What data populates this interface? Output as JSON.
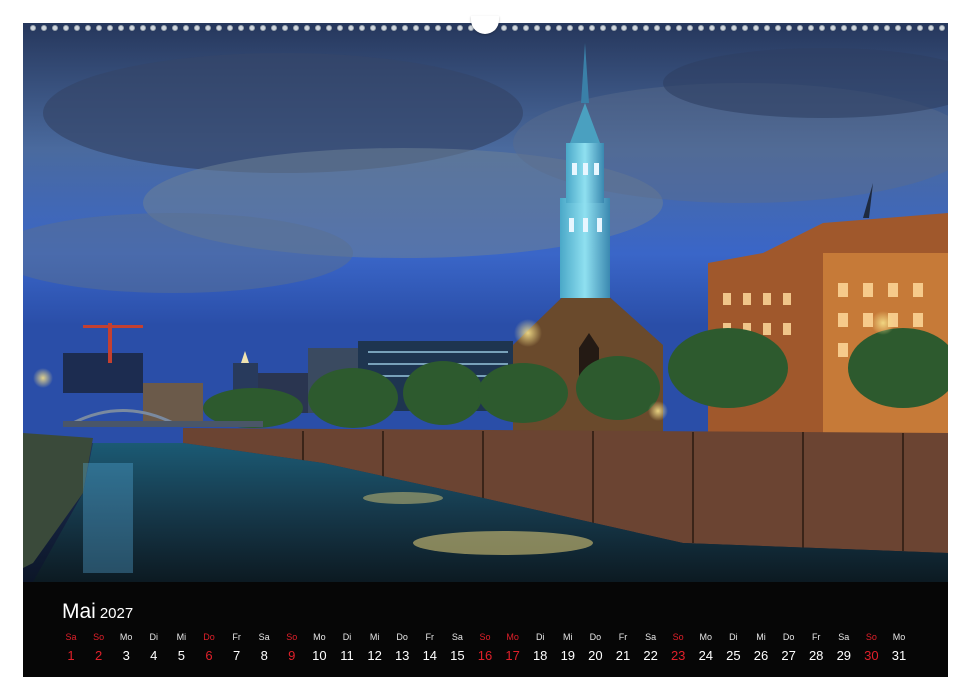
{
  "calendar": {
    "month": "Mai",
    "year": "2027",
    "days": [
      {
        "wd": "Sa",
        "num": "1",
        "red": true
      },
      {
        "wd": "So",
        "num": "2",
        "red": true
      },
      {
        "wd": "Mo",
        "num": "3",
        "red": false
      },
      {
        "wd": "Di",
        "num": "4",
        "red": false
      },
      {
        "wd": "Mi",
        "num": "5",
        "red": false
      },
      {
        "wd": "Do",
        "num": "6",
        "red": true
      },
      {
        "wd": "Fr",
        "num": "7",
        "red": false
      },
      {
        "wd": "Sa",
        "num": "8",
        "red": false
      },
      {
        "wd": "So",
        "num": "9",
        "red": true
      },
      {
        "wd": "Mo",
        "num": "10",
        "red": false
      },
      {
        "wd": "Di",
        "num": "11",
        "red": false
      },
      {
        "wd": "Mi",
        "num": "12",
        "red": false
      },
      {
        "wd": "Do",
        "num": "13",
        "red": false
      },
      {
        "wd": "Fr",
        "num": "14",
        "red": false
      },
      {
        "wd": "Sa",
        "num": "15",
        "red": false
      },
      {
        "wd": "So",
        "num": "16",
        "red": true
      },
      {
        "wd": "Mo",
        "num": "17",
        "red": true
      },
      {
        "wd": "Di",
        "num": "18",
        "red": false
      },
      {
        "wd": "Mi",
        "num": "19",
        "red": false
      },
      {
        "wd": "Do",
        "num": "20",
        "red": false
      },
      {
        "wd": "Fr",
        "num": "21",
        "red": false
      },
      {
        "wd": "Sa",
        "num": "22",
        "red": false
      },
      {
        "wd": "So",
        "num": "23",
        "red": true
      },
      {
        "wd": "Mo",
        "num": "24",
        "red": false
      },
      {
        "wd": "Di",
        "num": "25",
        "red": false
      },
      {
        "wd": "Mi",
        "num": "26",
        "red": false
      },
      {
        "wd": "Do",
        "num": "27",
        "red": false
      },
      {
        "wd": "Fr",
        "num": "28",
        "red": false
      },
      {
        "wd": "Sa",
        "num": "29",
        "red": false
      },
      {
        "wd": "So",
        "num": "30",
        "red": true
      },
      {
        "wd": "Mo",
        "num": "31",
        "red": false
      }
    ]
  },
  "colors": {
    "holiday": "#e0202a",
    "strip_background": "#060606",
    "text": "#ffffff"
  },
  "icons": {
    "binding": "spiral-binding-icon",
    "hanger": "hanger-notch-icon"
  }
}
